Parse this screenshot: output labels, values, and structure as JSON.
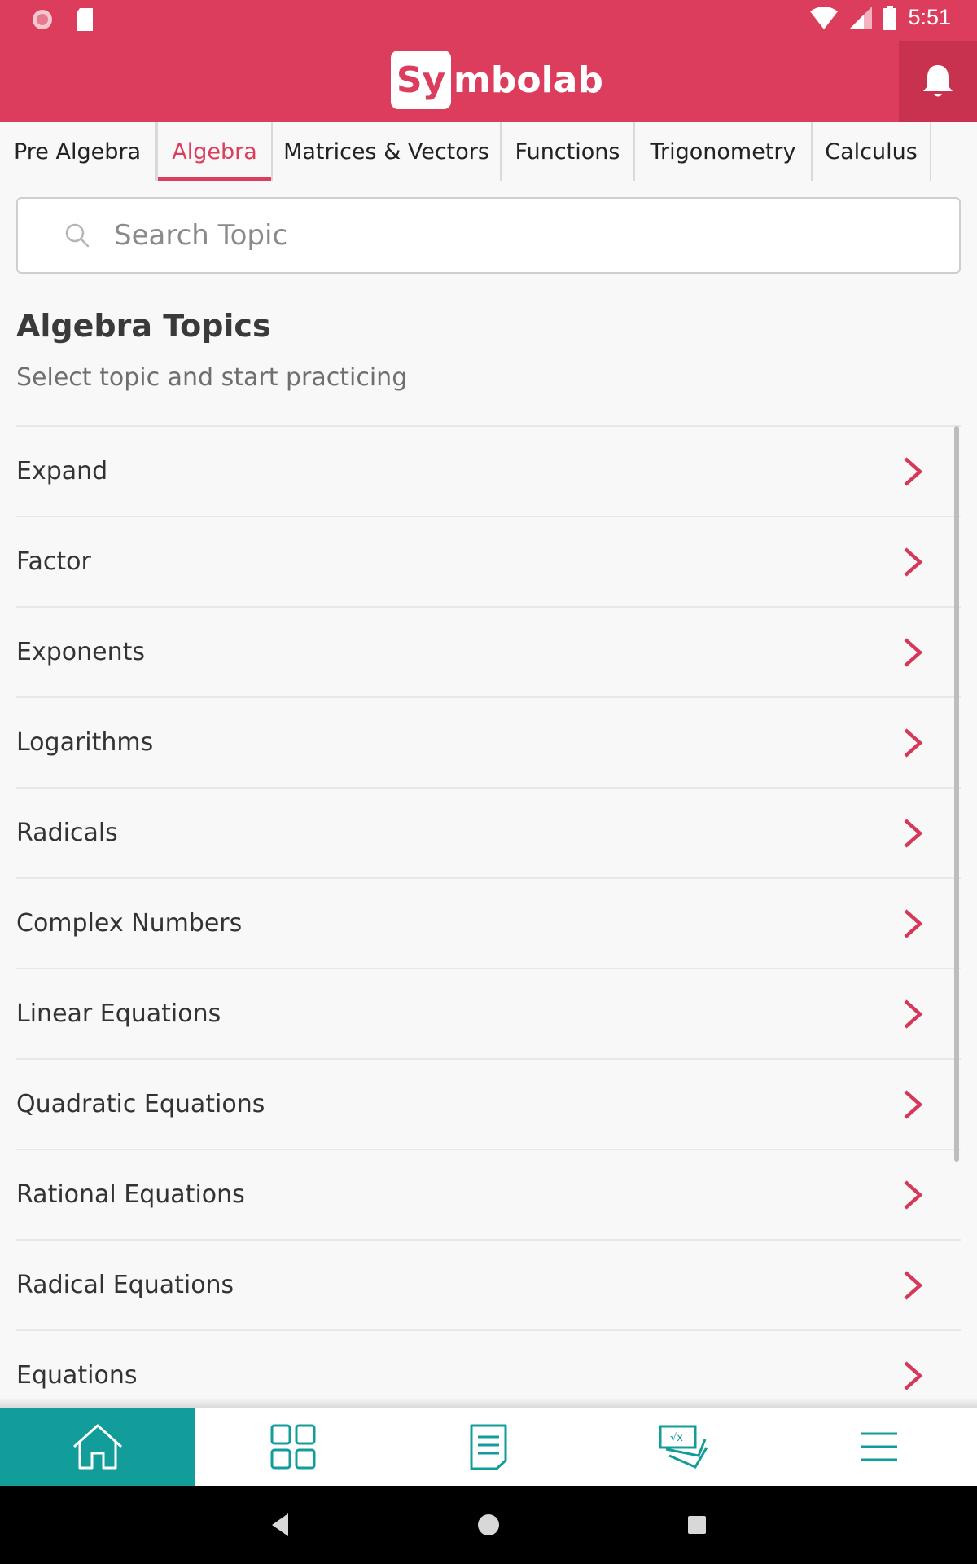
{
  "status_bar": {
    "time": "5:51",
    "icons": [
      "notification-icon",
      "sd-card-icon",
      "wifi-icon",
      "signal-icon",
      "battery-icon"
    ]
  },
  "header": {
    "logo_box": "Sy",
    "logo_rest": "mbolab",
    "bell_icon": "bell-icon",
    "color": "#dc3d5c"
  },
  "tabs": [
    {
      "label": "Pre Algebra",
      "active": false
    },
    {
      "label": "Algebra",
      "active": true
    },
    {
      "label": "Matrices & Vectors",
      "active": false
    },
    {
      "label": "Functions",
      "active": false
    },
    {
      "label": "Trigonometry",
      "active": false
    },
    {
      "label": "Calculus",
      "active": false
    }
  ],
  "search": {
    "placeholder": "Search Topic",
    "value": ""
  },
  "main": {
    "title": "Algebra Topics",
    "subtitle": "Select topic and start practicing",
    "topics": [
      "Expand",
      "Factor",
      "Exponents",
      "Logarithms",
      "Radicals",
      "Complex Numbers",
      "Linear Equations",
      "Quadratic Equations",
      "Rational Equations",
      "Radical Equations",
      "Equations"
    ]
  },
  "bottom_nav": {
    "items": [
      "home-icon",
      "grid-icon",
      "notes-icon",
      "practice-icon",
      "menu-icon"
    ],
    "active_index": 0,
    "accent": "#129c9a"
  },
  "system_nav": [
    "back-icon",
    "home-circle-icon",
    "recents-icon"
  ]
}
